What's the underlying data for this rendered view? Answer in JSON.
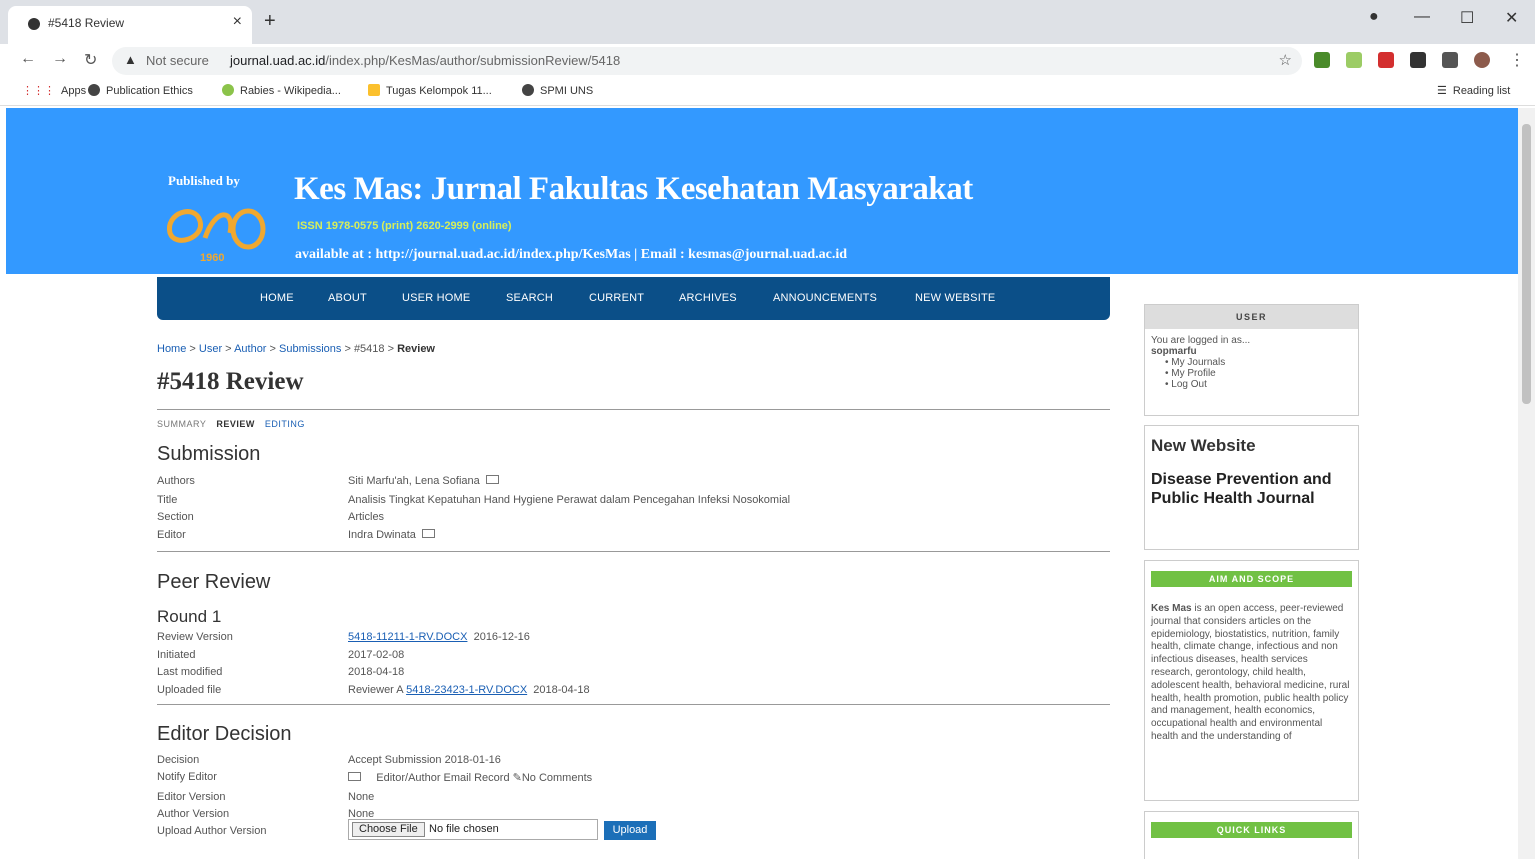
{
  "browser": {
    "tab_title": "#5418 Review",
    "tab_close": "×",
    "new_tab": "+",
    "address_warning": "Not secure",
    "url_host": "journal.uad.ac.id",
    "url_path": "/index.php/KesMas/author/submissionReview/5418",
    "bookmarks": [
      "Apps",
      "Publication Ethics",
      "Rabies - Wikipedia...",
      "Tugas Kelompok 11...",
      "SPMI UNS"
    ],
    "reading_list": "Reading list",
    "icons": [
      "back-icon",
      "forward-icon",
      "reload-icon",
      "star-icon",
      "minimize-icon",
      "maximize-icon",
      "close-icon"
    ]
  },
  "header": {
    "published_by": "Published by",
    "logo_year": "1960",
    "title": "Kes Mas: Jurnal Fakultas Kesehatan Masyarakat",
    "issn": "ISSN 1978-0575 (print) 2620-2999 (online)",
    "available": "available at : http://journal.uad.ac.id/index.php/KesMas  | Email : kesmas@journal.uad.ac.id"
  },
  "nav": [
    "HOME",
    "ABOUT",
    "USER HOME",
    "SEARCH",
    "CURRENT",
    "ARCHIVES",
    "ANNOUNCEMENTS",
    "NEW WEBSITE"
  ],
  "breadcrumb": {
    "home": "Home",
    "user": "User",
    "author": "Author",
    "submissions": "Submissions",
    "id": "#5418",
    "current": "Review",
    "sep": " > "
  },
  "page_title": "#5418 Review",
  "subnav": {
    "summary": "SUMMARY",
    "review": "REVIEW",
    "editing": "EDITING"
  },
  "submission": {
    "heading": "Submission",
    "labels": {
      "authors": "Authors",
      "title": "Title",
      "section": "Section",
      "editor": "Editor"
    },
    "authors": "Siti Marfu'ah, Lena Sofiana",
    "title": "Analisis Tingkat Kepatuhan Hand Hygiene Perawat dalam Pencegahan Infeksi Nosokomial",
    "section": "Articles",
    "editor": "Indra Dwinata"
  },
  "peer_review": {
    "heading": "Peer Review",
    "round": "Round 1",
    "labels": {
      "review_version": "Review Version",
      "initiated": "Initiated",
      "last_modified": "Last modified",
      "uploaded_file": "Uploaded file"
    },
    "review_version_file": "5418-11211-1-RV.DOCX",
    "review_version_date": "2016-12-16",
    "initiated": "2017-02-08",
    "last_modified": "2018-04-18",
    "uploaded_reviewer": "Reviewer A",
    "uploaded_file": "5418-23423-1-RV.DOCX",
    "uploaded_date": "2018-04-18"
  },
  "editor_decision": {
    "heading": "Editor Decision",
    "labels": {
      "decision": "Decision",
      "notify_editor": "Notify Editor",
      "editor_version": "Editor Version",
      "author_version": "Author Version",
      "upload_author_version": "Upload Author Version"
    },
    "decision": "Accept Submission 2018-01-16",
    "email_record": "Editor/Author Email Record",
    "comments": "No Comments",
    "editor_version": "None",
    "author_version": "None",
    "choose_file": "Choose File",
    "no_file": "No file chosen",
    "upload": "Upload"
  },
  "sidebar": {
    "user_head": "USER",
    "logged_in_as": "You are logged in as...",
    "username": "sopmarfu",
    "user_links": [
      "My Journals",
      "My Profile",
      "Log Out"
    ],
    "new_website_title": "New Website",
    "new_website_link": "Disease Prevention and Public Health Journal",
    "aim_head": "AIM AND SCOPE",
    "aim_bold": "Kes Mas",
    "aim_text": " is an open access, peer-reviewed journal that considers articles on the epidemiology, biostatistics, nutrition, family health, climate change, infectious and non infectious diseases, health services research, gerontology, child health, adolescent health, behavioral medicine, rural health, health promotion, public health policy and management, health economics, occupational health and environmental health and the understanding of",
    "quick_head": "QUICK LINKS"
  },
  "colors": {
    "banner": "#3399ff",
    "navbar": "#0b4f88",
    "green": "#71c144",
    "link": "#1a5fb4"
  }
}
